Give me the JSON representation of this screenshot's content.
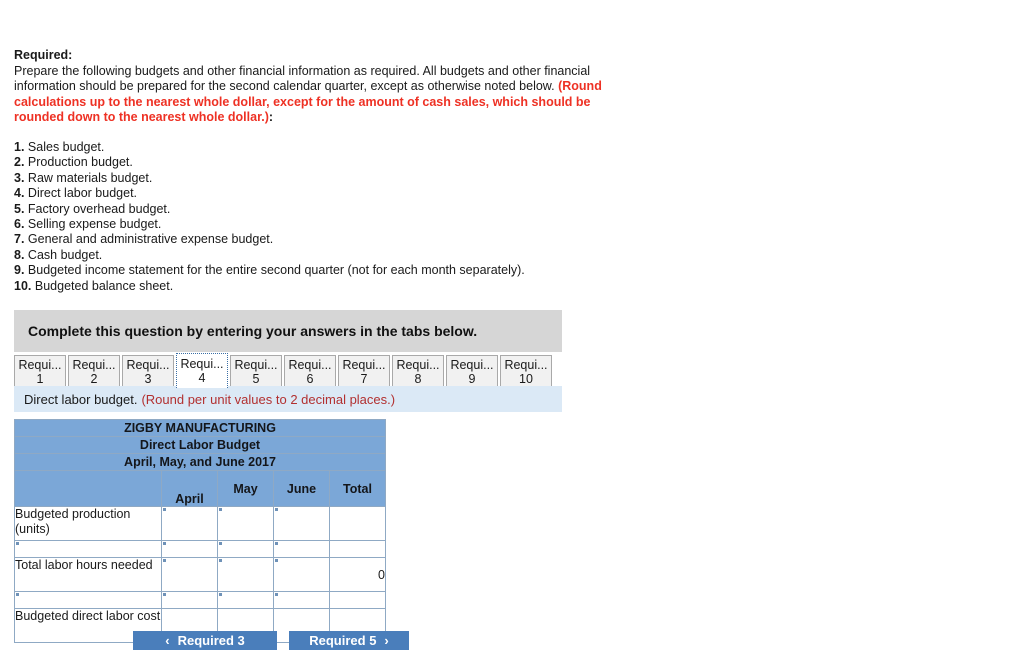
{
  "prompt": {
    "heading": "Required:",
    "paragraph_part1": "Prepare the following budgets and other financial information as required. All budgets and other financial information should be prepared for the second calendar quarter, except as otherwise noted below. ",
    "paragraph_red": "(Round calculations up to the nearest whole dollar, except for the amount of cash sales, which should be rounded down to the nearest whole dollar.)",
    "paragraph_end": ":"
  },
  "requirements": [
    {
      "num": "1.",
      "text": "Sales budget."
    },
    {
      "num": "2.",
      "text": "Production budget."
    },
    {
      "num": "3.",
      "text": "Raw materials budget."
    },
    {
      "num": "4.",
      "text": "Direct labor budget."
    },
    {
      "num": "5.",
      "text": "Factory overhead budget."
    },
    {
      "num": "6.",
      "text": "Selling expense budget."
    },
    {
      "num": "7.",
      "text": "General and administrative expense budget."
    },
    {
      "num": "8.",
      "text": "Cash budget."
    },
    {
      "num": "9.",
      "text": "Budgeted income statement for the entire second quarter (not for each month separately)."
    },
    {
      "num": "10.",
      "text": "Budgeted balance sheet."
    }
  ],
  "banner": {
    "text": "Complete this question by entering your answers in the tabs below."
  },
  "tabs": [
    {
      "label": "Requi...",
      "num": "1",
      "selected": false
    },
    {
      "label": "Requi...",
      "num": "2",
      "selected": false
    },
    {
      "label": "Requi...",
      "num": "3",
      "selected": false
    },
    {
      "label": "Requi...",
      "num": "4",
      "selected": true
    },
    {
      "label": "Requi...",
      "num": "5",
      "selected": false
    },
    {
      "label": "Requi...",
      "num": "6",
      "selected": false
    },
    {
      "label": "Requi...",
      "num": "7",
      "selected": false
    },
    {
      "label": "Requi...",
      "num": "8",
      "selected": false
    },
    {
      "label": "Requi...",
      "num": "9",
      "selected": false
    },
    {
      "label": "Requi...",
      "num": "10",
      "selected": false
    }
  ],
  "sub_instruction": {
    "main": "Direct labor budget.",
    "red": "(Round per unit values to 2 decimal places.)"
  },
  "table": {
    "title_line1": "ZIGBY MANUFACTURING",
    "title_line2": "Direct Labor Budget",
    "title_line3": "April, May, and June 2017",
    "column_headers": [
      "",
      "April",
      "May",
      "June",
      "Total"
    ],
    "rows": [
      {
        "label": "Budgeted production (units)",
        "type": "tall",
        "april": "",
        "may": "",
        "june": "",
        "total": ""
      },
      {
        "label": "",
        "type": "thin",
        "april": "",
        "may": "",
        "june": "",
        "total": ""
      },
      {
        "label": "Total labor hours needed",
        "type": "tall",
        "april": "",
        "may": "",
        "june": "",
        "total": "0"
      },
      {
        "label": "",
        "type": "thin",
        "april": "",
        "may": "",
        "june": "",
        "total": ""
      },
      {
        "label": "Budgeted direct labor cost",
        "type": "tall",
        "april": "",
        "may": "",
        "june": "",
        "total": ""
      }
    ]
  },
  "nav": {
    "prev_label": "Required 3",
    "next_label": "Required 5",
    "prev_chevron": "‹",
    "next_chevron": "›"
  },
  "colors": {
    "table_header_blue": "#7ba7d7",
    "instruction_blue": "#dbe9f6",
    "banner_gray": "#d6d6d6",
    "button_blue": "#4a7ebb",
    "bright_red": "#ee3124",
    "brick_red": "#b23030"
  }
}
